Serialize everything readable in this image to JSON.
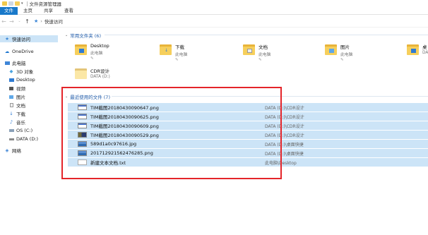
{
  "window": {
    "title": "文件资源管理器"
  },
  "ribbon": {
    "tabs": [
      "文件",
      "主页",
      "共享",
      "查看"
    ]
  },
  "address": {
    "location": "快速访问"
  },
  "sidebar": {
    "items": [
      {
        "label": "快速访问",
        "icon": "star-icon",
        "selected": true
      },
      {
        "label": "OneDrive",
        "icon": "cloud-icon"
      },
      {
        "label": "此电脑",
        "icon": "computer-icon"
      },
      {
        "label": "3D 对象",
        "icon": "cube-icon"
      },
      {
        "label": "Desktop",
        "icon": "desktop-icon"
      },
      {
        "label": "视频",
        "icon": "video-icon"
      },
      {
        "label": "图片",
        "icon": "picture-icon"
      },
      {
        "label": "文档",
        "icon": "document-icon"
      },
      {
        "label": "下载",
        "icon": "download-icon"
      },
      {
        "label": "音乐",
        "icon": "music-icon"
      },
      {
        "label": "OS (C:)",
        "icon": "drive-icon"
      },
      {
        "label": "DATA (D:)",
        "icon": "drive-icon"
      },
      {
        "label": "网络",
        "icon": "network-icon"
      }
    ]
  },
  "frequent": {
    "header": "常用文件夹 (6)",
    "folders": [
      {
        "name": "Desktop",
        "sub": "此电脑"
      },
      {
        "name": "下载",
        "sub": "此电脑"
      },
      {
        "name": "文档",
        "sub": "此电脑"
      },
      {
        "name": "图片",
        "sub": "此电脑"
      },
      {
        "name": "桌",
        "sub": "DA"
      },
      {
        "name": "CDR设计",
        "sub": "DATA (D:)"
      }
    ]
  },
  "recent": {
    "header": "最近使用的文件 (7)",
    "files": [
      {
        "name": "TIM截图20180430090647.png",
        "location": "DATA (D:)\\CDR设计",
        "icon": "bar"
      },
      {
        "name": "TIM截图20180430090625.png",
        "location": "DATA (D:)\\CDR设计",
        "icon": "bar"
      },
      {
        "name": "TIM截图20180430090609.png",
        "location": "DATA (D:)\\CDR设计",
        "icon": "bar"
      },
      {
        "name": "TIM截图20180430090529.png",
        "location": "DATA (D:)\\CDR设计",
        "icon": "dark"
      },
      {
        "name": "589d1a0c97616.jpg",
        "location": "DATA (D:)\\桌面快捷",
        "icon": "photo"
      },
      {
        "name": "2017129215624762​85.png",
        "location": "DATA (D:)\\桌面快捷",
        "icon": "photo"
      },
      {
        "name": "新建文本文档.txt",
        "location": "此电脑\\Desktop",
        "icon": "txt"
      }
    ]
  },
  "colors": {
    "accent": "#1979ca",
    "selection": "#cce4f7",
    "highlight": "#e4252a",
    "folder": "#f6cf5c"
  }
}
